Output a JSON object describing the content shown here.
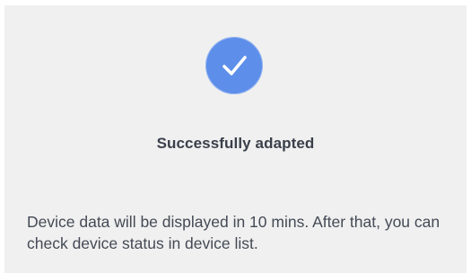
{
  "icon": {
    "name": "check-circle-icon",
    "color": "#5d8eea"
  },
  "title": "Successfully adapted",
  "message": "Device data will be displayed in 10 mins. After that, you can check device status in device list."
}
